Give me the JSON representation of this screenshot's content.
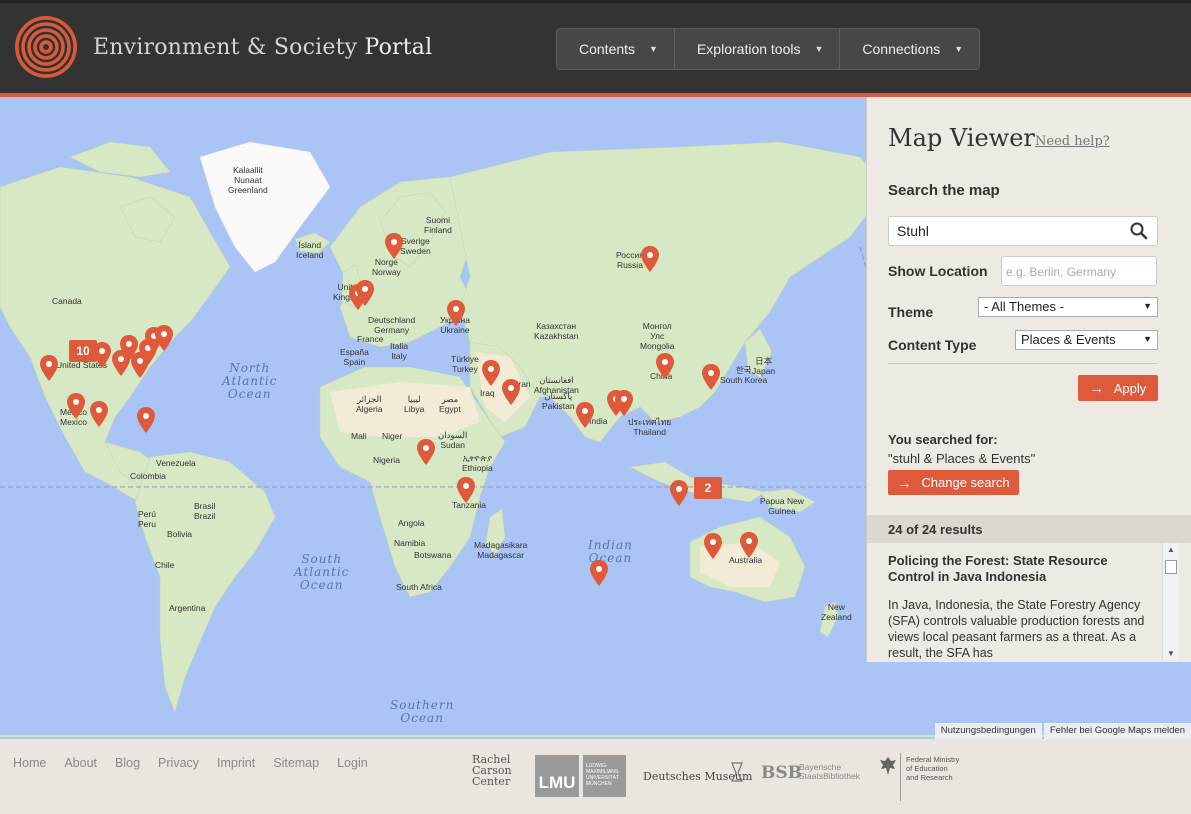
{
  "header": {
    "brand_main": "Environment & Society",
    "brand_strong": "Portal",
    "nav": [
      {
        "label": "Contents"
      },
      {
        "label": "Exploration tools"
      },
      {
        "label": "Connections"
      }
    ]
  },
  "map": {
    "labels": {
      "greenland": "Kalaallit\nNunaat\nGreenland",
      "iceland": "Ísland\nIceland",
      "canada": "Canada",
      "norway": "Norge\nNorway",
      "sweden": "Sverige\nSweden",
      "finland": "Suomi\nFinland",
      "russia": "Россия\nRussia",
      "uk": "United\nKingdom",
      "germany": "Deutschland\nGermany",
      "ukraine": "Україна\nUkraine",
      "kazakhstan": "Казахстан\nKazakhstan",
      "mongolia": "Монгол\nУлс\nMongolia",
      "france": "France",
      "italy": "Italia\nItaly",
      "spain": "España\nSpain",
      "turkey": "Türkiye\nTurkey",
      "japan": "日本\nJapan",
      "south_korea": "한국\nSouth Korea",
      "china": "China",
      "afghanistan": "افغانستان\nAfghanistan",
      "pakistan": "پاکستان\nPakistan",
      "iraq": "Iraq",
      "iran": "Iran",
      "india": "India",
      "thailand": "ประเทศไทย\nThailand",
      "usa": "United States",
      "mexico": "México\nMexico",
      "algeria": "الجزائر\nAlgeria",
      "libya": "ليبيا\nLibya",
      "egypt": "مصر\nEgypt",
      "mali": "Mali",
      "niger": "Niger",
      "sudan": "السودان\nSudan",
      "nigeria": "Nigeria",
      "ethiopia": "ኢትዮጵያ\nEthiopia",
      "tanzania": "Tanzania",
      "angola": "Angola",
      "namibia": "Namibia",
      "botswana": "Botswana",
      "madagascar": "Madagasikara\nMadagascar",
      "south_africa": "South Africa",
      "venezuela": "Venezuela",
      "colombia": "Colombia",
      "peru": "Perú\nPeru",
      "brasil": "Brasil\nBrazil",
      "bolivia": "Bolivia",
      "chile": "Chile",
      "argentina": "Argentina",
      "papua": "Papua New\nGuinea",
      "australia": "Australia",
      "new_zealand": "New\nZealand"
    },
    "oceans": {
      "north_atlantic": "North\nAtlantic\nOcean",
      "south_atlantic": "South\nAtlantic\nOcean",
      "indian": "Indian\nOcean",
      "southern": "Southern\nOcean"
    },
    "clusters": {
      "usa_cluster": "10",
      "indonesia_cluster": "2"
    },
    "footer_terms": "Nutzungsbedingungen",
    "footer_report": "Fehler bei Google Maps melden",
    "pin_color": "#df5a3a"
  },
  "panel": {
    "title": "Map Viewer",
    "need_help": "Need help?",
    "search_heading": "Search the map",
    "search_value": "Stuhl",
    "show_location_label": "Show Location",
    "location_placeholder": "e.g. Berlin, Germany",
    "theme_label": "Theme",
    "theme_value": "- All Themes -",
    "content_type_label": "Content Type",
    "content_type_value": "Places & Events",
    "apply_label": "Apply",
    "you_searched_label": "You searched for:",
    "searched_value": "\"stuhl & Places & Events\"",
    "change_search_label": "Change search",
    "results_count": "24 of 24 results",
    "result": {
      "title": "Policing the Forest: State Resource Control in Java Indonesia",
      "description": "In Java, Indonesia, the State Forestry Agency (SFA) controls valuable production forests and views local peasant farmers as a threat. As a result, the SFA has"
    }
  },
  "footer": {
    "links": [
      "Home",
      "About",
      "Blog",
      "Privacy",
      "Imprint",
      "Sitemap",
      "Login"
    ],
    "sponsors": {
      "rcc": "Rachel\nCarson\nCenter",
      "lmu": "LMU",
      "lmu_sub": "LUDWIG-\nMAXIMILIANS-\nUNIVERSITÄT\nMÜNCHEN",
      "museum": "Deutsches Museum",
      "bsb": "BSB",
      "bsb_sub": "Bayerische\nStaatsBibliothek",
      "ministry": "Federal Ministry\nof Education\nand Research"
    }
  },
  "colors": {
    "accent": "#df5a3a",
    "header_bg": "#333333",
    "ocean": "#a9c4f5",
    "land": "#d7e8c4",
    "panel_bg": "#ede9e3"
  }
}
